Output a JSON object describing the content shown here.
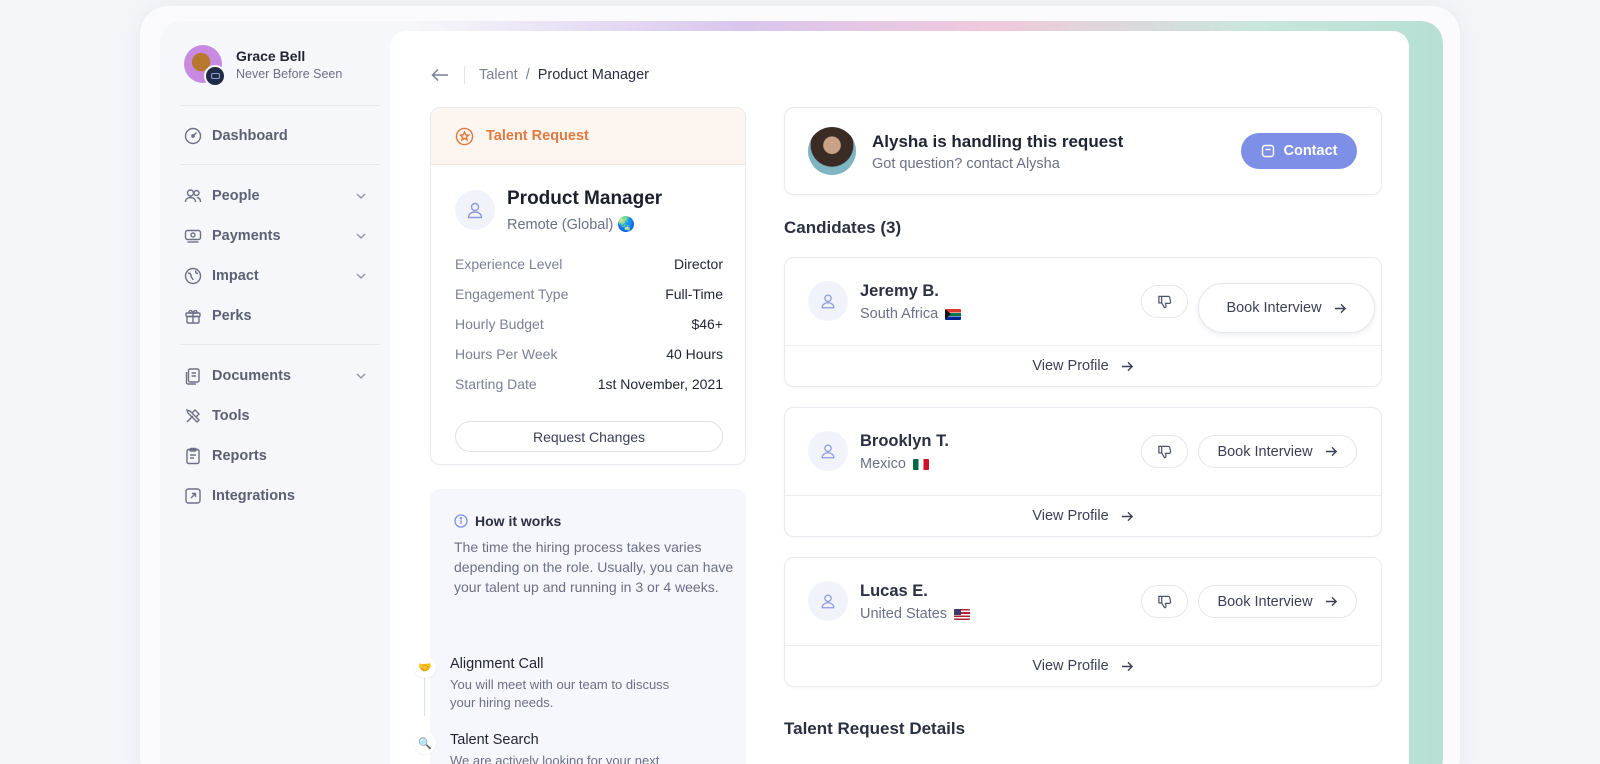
{
  "profile": {
    "name": "Grace Bell",
    "subtitle": "Never Before Seen"
  },
  "sidebar": {
    "items": [
      {
        "label": "Dashboard",
        "icon": "dashboard-icon",
        "has_chevron": false
      },
      {
        "label": "People",
        "icon": "people-icon",
        "has_chevron": true
      },
      {
        "label": "Payments",
        "icon": "payments-icon",
        "has_chevron": true
      },
      {
        "label": "Impact",
        "icon": "impact-icon",
        "has_chevron": true
      },
      {
        "label": "Perks",
        "icon": "gift-icon",
        "has_chevron": false
      },
      {
        "label": "Documents",
        "icon": "documents-icon",
        "has_chevron": true
      },
      {
        "label": "Tools",
        "icon": "tools-icon",
        "has_chevron": false
      },
      {
        "label": "Reports",
        "icon": "reports-icon",
        "has_chevron": false
      },
      {
        "label": "Integrations",
        "icon": "integrations-icon",
        "has_chevron": false
      }
    ]
  },
  "breadcrumb": {
    "parent": "Talent",
    "separator": "/",
    "current": "Product Manager"
  },
  "talent_request": {
    "header": "Talent Request",
    "role": "Product Manager",
    "location": "Remote (Global)",
    "location_emoji": "🌏",
    "details": [
      {
        "key": "Experience Level",
        "value": "Director"
      },
      {
        "key": "Engagement Type",
        "value": "Full-Time"
      },
      {
        "key": "Hourly Budget",
        "value": "$46+"
      },
      {
        "key": "Hours Per Week",
        "value": "40 Hours"
      },
      {
        "key": "Starting Date",
        "value": "1st November, 2021"
      }
    ],
    "request_changes_label": "Request Changes"
  },
  "how_it_works": {
    "title": "How it works",
    "text": "The time the hiring process takes varies depending on the role. Usually, you can have your talent up and running in 3 or 4 weeks.",
    "steps": [
      {
        "emoji": "🤝",
        "title": "Alignment Call",
        "desc": "You will meet with our team to discuss your hiring needs."
      },
      {
        "emoji": "🔍",
        "title": "Talent Search",
        "desc": "We are actively looking for your next"
      }
    ]
  },
  "handler": {
    "title": "Alysha is handling this request",
    "subtitle": "Got question? contact Alysha",
    "contact_label": "Contact"
  },
  "candidates": {
    "title": "Candidates (3)",
    "book_label": "Book Interview",
    "view_label": "View Profile",
    "items": [
      {
        "name": "Jeremy B.",
        "location": "South Africa",
        "flag": "za"
      },
      {
        "name": "Brooklyn T.",
        "location": "Mexico",
        "flag": "mx"
      },
      {
        "name": "Lucas E.",
        "location": "United States",
        "flag": "us"
      }
    ]
  },
  "details_section": {
    "title": "Talent Request Details"
  },
  "colors": {
    "accent": "#7d8fe6",
    "talent_orange": "#e07a3f"
  }
}
